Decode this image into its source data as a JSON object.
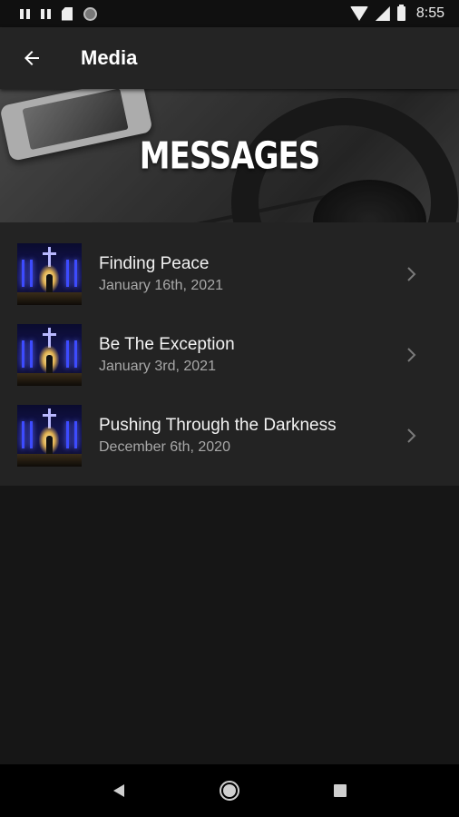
{
  "status_bar": {
    "time": "8:55",
    "icons": [
      "pause-icon",
      "pause-icon",
      "sd-card-icon",
      "record-icon",
      "wifi-icon",
      "signal-icon",
      "battery-icon"
    ]
  },
  "app_bar": {
    "back_icon": "arrow-back-icon",
    "title": "Media"
  },
  "banner": {
    "title": "MESSAGES"
  },
  "messages": [
    {
      "title": "Finding Peace",
      "date": "January 16th, 2021"
    },
    {
      "title": "Be The Exception",
      "date": "January 3rd, 2021"
    },
    {
      "title": "Pushing Through the Darkness",
      "date": "December 6th, 2020"
    }
  ],
  "nav_bar": {
    "icons": [
      "back-triangle-icon",
      "home-circle-icon",
      "recents-square-icon"
    ]
  },
  "colors": {
    "background": "#161616",
    "app_bar": "#242424",
    "list_background": "#232323",
    "text_primary": "#f2f2f2",
    "text_secondary": "#a8a8a8"
  }
}
